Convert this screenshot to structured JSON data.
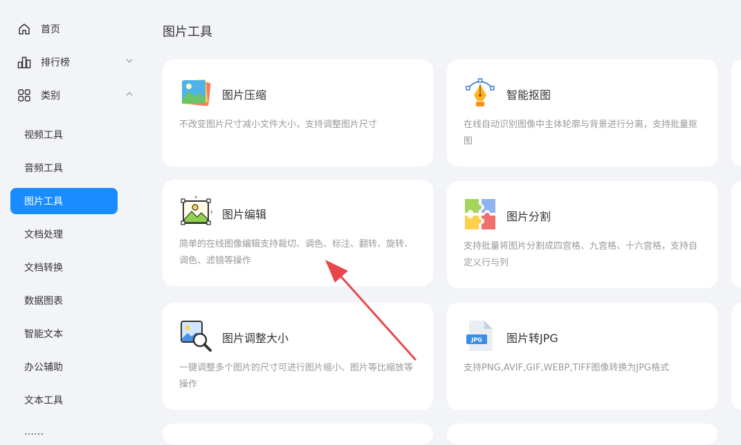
{
  "sidebar": {
    "top_items": [
      {
        "label": "首页",
        "icon": "home-icon"
      },
      {
        "label": "排行榜",
        "icon": "bar-chart-icon",
        "expanded": false
      },
      {
        "label": "类别",
        "icon": "grid-icon",
        "expanded": true
      }
    ],
    "categories": [
      {
        "label": "视频工具",
        "active": false
      },
      {
        "label": "音频工具",
        "active": false
      },
      {
        "label": "图片工具",
        "active": true
      },
      {
        "label": "文档处理",
        "active": false
      },
      {
        "label": "文档转换",
        "active": false
      },
      {
        "label": "数据图表",
        "active": false
      },
      {
        "label": "智能文本",
        "active": false
      },
      {
        "label": "办公辅助",
        "active": false
      },
      {
        "label": "文本工具",
        "active": false
      },
      {
        "label": "……",
        "active": false
      }
    ]
  },
  "main": {
    "title": "图片工具",
    "cards": [
      {
        "title": "图片压缩",
        "desc": "不改变图片尺寸减小文件大小，支持调整图片尺寸",
        "icon": "image-compress-icon"
      },
      {
        "title": "智能抠图",
        "desc": "在线自动识别图像中主体轮廓与背景进行分离，支持批量抠图",
        "icon": "pen-tool-icon"
      },
      {
        "title": "图片编辑",
        "desc": "简单的在线图像编辑支持裁切、调色、标注、翻转、旋转、调色、滤镜等操作",
        "icon": "image-edit-icon"
      },
      {
        "title": "图片分割",
        "desc": "支持批量将图片分割成四宫格、九宫格、十六宫格，支持自定义行与列",
        "icon": "puzzle-icon"
      },
      {
        "title": "图片调整大小",
        "desc": "一键调整多个图片的尺寸可进行图片缩小、图片等比缩放等操作",
        "icon": "image-resize-icon"
      },
      {
        "title": "图片转JPG",
        "desc": "支持PNG,AVIF,GIF,WEBP,TIFF图像转换为JPG格式",
        "icon": "jpg-file-icon",
        "badge": "JPG"
      }
    ]
  },
  "colors": {
    "accent": "#1a8cff",
    "arrow": "#e8474a",
    "bg": "#f3f4f7"
  }
}
